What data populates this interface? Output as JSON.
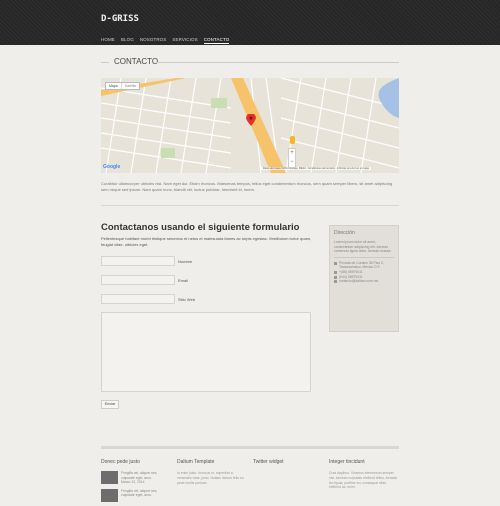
{
  "header": {
    "logo": "D-GRISS",
    "nav": [
      "Home",
      "Blog",
      "Nosotros",
      "Servicios",
      "Contacto"
    ],
    "active_nav": "Contacto"
  },
  "page": {
    "title": "CONTACTO"
  },
  "map": {
    "type_buttons": [
      "Mapa",
      "Satélite"
    ],
    "brand": "Google",
    "credit": "Datos del mapa ©2014 Google, INEGI · Condiciones del servicio · Informar un error en el mapa",
    "zoom_in": "+",
    "zoom_out": "−"
  },
  "intro_text": "Curabitur ullamcorper ultricies nisi. Nam eget dui. Etiam rhoncus. Maecenas tempus, tellus eget condimentum rhoncus, sem quam semper libero, sit amet adipiscing sem neque sed ipsum. Nam quam nunc, blandit vel, luctus pulvinar, hendrerit id, lorem.",
  "form": {
    "title": "Contactanos usando el siguiente formulario",
    "intro": "Pellentesque habitant morbi tristique senectus et netus et malesuada fames ac turpis egestas. Vestibulum tortor quam, feugiat vitae, ultricies eget.",
    "fields": [
      {
        "label": "Nombre"
      },
      {
        "label": "Email"
      },
      {
        "label": "Sitio Web"
      }
    ],
    "submit": "Enviar"
  },
  "address": {
    "title": "Dirección",
    "text": "Lorem ipsum dolor sit amet, consectetuer adipiscing elit. Aenean commodo ligula dolor. Aenean massa.",
    "location": "Privada de Corales 38 Piso 2, Tecamachalco, México D.F.",
    "phone1": "+(55) 55979411",
    "phone2": "(044) 55979411",
    "email": "contacto@daltum.com.mx"
  },
  "footer": {
    "col1": {
      "title": "Donec pede justo",
      "posts": [
        {
          "text": "Fringilla vel, aliquet nec, vulputate eget, arcu.",
          "date": "Marzo 12, 2014"
        },
        {
          "text": "Fringilla vel, aliquet nec, vulputate eget, arcu."
        }
      ]
    },
    "col2": {
      "title": "Daltum Template",
      "text": "In enim justo, rhoncus ut, imperdiet a, venenatis vitae, justo. Nullam dictum felis eu pede mollis pretium."
    },
    "col3": {
      "title": "Twitter widget"
    },
    "col4": {
      "title": "Integer tincidunt",
      "text": "Cras dapibus. Vivamus elementum semper nisi. Aenean vulputate eleifend tellus. Aenean leo ligula, porttitor eu, consequat vitae, eleifend ac, enim."
    },
    "colors": {
      "thumb": "#6d6d6d"
    }
  }
}
